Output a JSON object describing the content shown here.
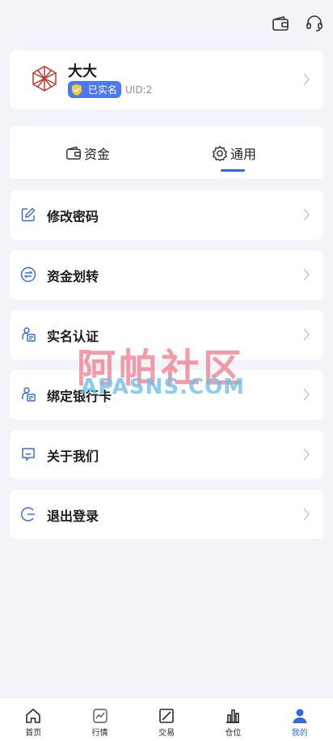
{
  "header": {
    "icons": [
      "wallet-icon",
      "headset-icon"
    ]
  },
  "profile": {
    "name": "大大",
    "verified_label": "已实名",
    "uid": "UID:2"
  },
  "tabs": [
    {
      "label": "资金",
      "icon": "wallet-icon",
      "active": false
    },
    {
      "label": "通用",
      "icon": "gear-icon",
      "active": true
    }
  ],
  "menu": [
    {
      "label": "修改密码",
      "icon": "edit-icon"
    },
    {
      "label": "资金划转",
      "icon": "transfer-icon"
    },
    {
      "label": "实名认证",
      "icon": "id-card-icon"
    },
    {
      "label": "绑定银行卡",
      "icon": "bank-card-icon"
    },
    {
      "label": "关于我们",
      "icon": "chat-icon"
    },
    {
      "label": "退出登录",
      "icon": "logout-icon"
    }
  ],
  "watermark": {
    "line1": "阿帕社区",
    "line2": "APASNS.COM"
  },
  "bottom_nav": [
    {
      "label": "首页",
      "icon": "home-icon",
      "active": false
    },
    {
      "label": "行情",
      "icon": "market-icon",
      "active": false
    },
    {
      "label": "交易",
      "icon": "trade-icon",
      "active": false
    },
    {
      "label": "仓位",
      "icon": "position-icon",
      "active": false
    },
    {
      "label": "我的",
      "icon": "user-icon",
      "active": true
    }
  ],
  "colors": {
    "accent": "#2f6ae6",
    "badge": "#4d78f0",
    "background": "#f3f4f9",
    "avatar": "#c0392b"
  }
}
